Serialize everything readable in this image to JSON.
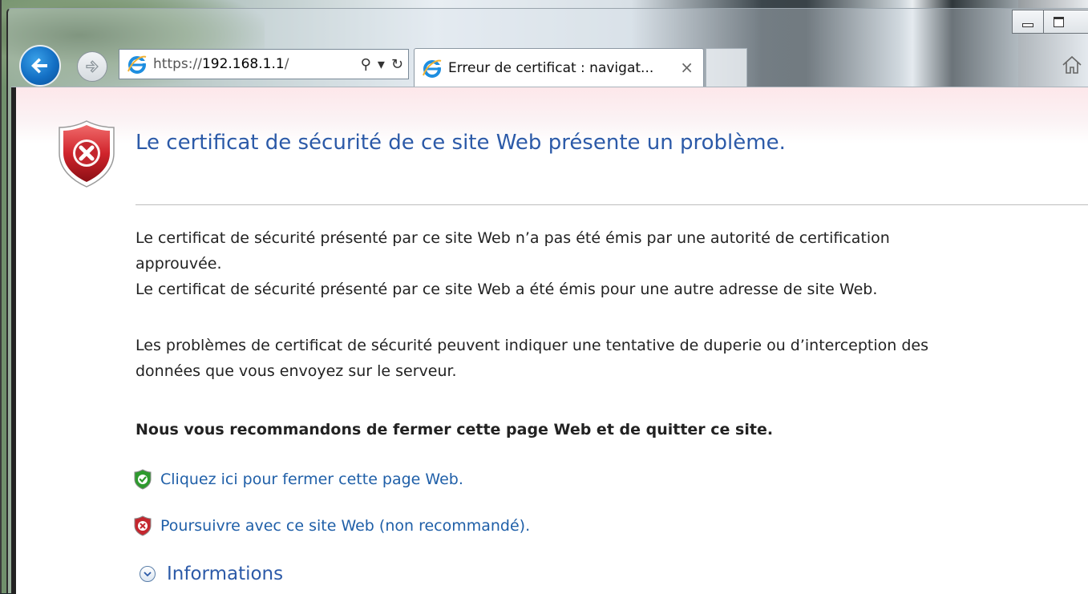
{
  "browser": {
    "address": {
      "scheme": "https://",
      "host": "192.168.1.1",
      "path": "/"
    },
    "address_tools": {
      "search_glyph": "⚲",
      "dropdown_glyph": "▾",
      "refresh_glyph": "↻"
    },
    "tab": {
      "title": "Erreur de certificat : navigat...",
      "close_glyph": "×"
    },
    "icons": {
      "back": "back-arrow-icon",
      "forward": "forward-arrow-icon",
      "page": "ie-logo-icon",
      "home": "home-icon"
    }
  },
  "page": {
    "title": "Le certificat de sécurité de ce site Web présente un problème.",
    "paragraph1_line1": "Le certificat de sécurité présenté par ce site Web n’a pas été émis par une autorité de certification",
    "paragraph1_line2": "approuvée.",
    "paragraph2": "Le certificat de sécurité présenté par ce site Web a été émis pour une autre adresse de site Web.",
    "paragraph3_line1": "Les problèmes de certificat de sécurité peuvent indiquer une tentative de duperie ou d’interception des",
    "paragraph3_line2": "données que vous envoyez sur le serveur.",
    "recommendation": "Nous vous recommandons de fermer cette page Web et de quitter ce site.",
    "close_link": "Cliquez ici pour fermer cette page Web.",
    "continue_link": "Poursuivre avec ce site Web (non recommandé).",
    "info_toggle": "Informations"
  },
  "colors": {
    "title_blue": "#2c5aa8",
    "link_blue": "#1f5fa8",
    "shield_red": "#c4262e",
    "shield_green": "#2e9a2e"
  }
}
